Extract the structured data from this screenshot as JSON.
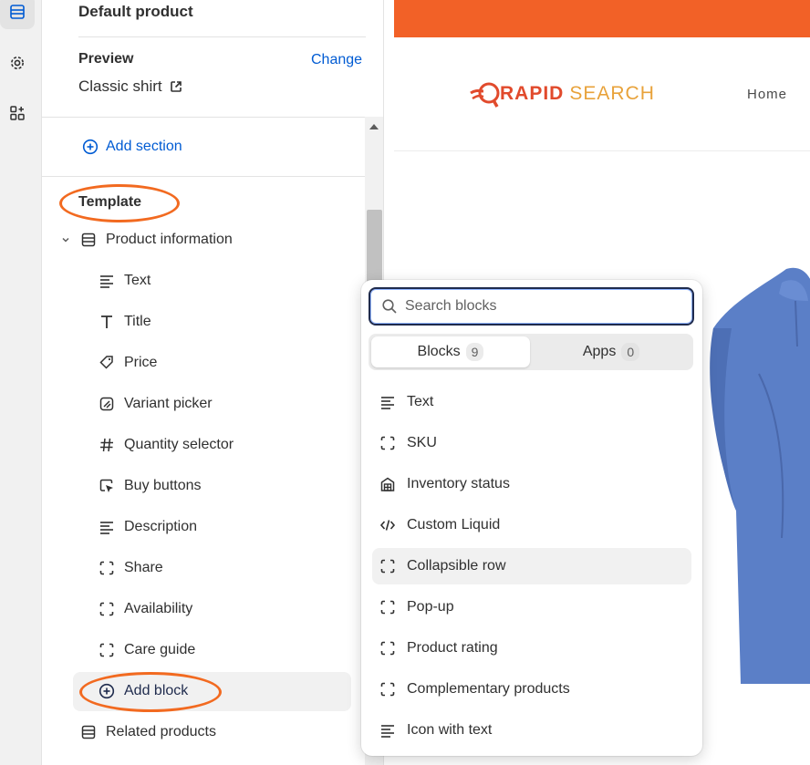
{
  "rail": {
    "items": [
      {
        "icon": "sections-icon",
        "active": true
      },
      {
        "icon": "gear-icon",
        "active": false
      },
      {
        "icon": "apps-icon",
        "active": false
      }
    ]
  },
  "panel": {
    "title": "Default product",
    "preview_label": "Preview",
    "preview_change": "Change",
    "preview_value": "Classic shirt",
    "add_section": "Add section",
    "template_label": "Template",
    "section_name": "Product information",
    "blocks": [
      {
        "label": "Text",
        "icon": "text-icon"
      },
      {
        "label": "Title",
        "icon": "title-icon"
      },
      {
        "label": "Price",
        "icon": "price-tag-icon"
      },
      {
        "label": "Variant picker",
        "icon": "variant-icon"
      },
      {
        "label": "Quantity selector",
        "icon": "hash-icon"
      },
      {
        "label": "Buy buttons",
        "icon": "cursor-icon"
      },
      {
        "label": "Description",
        "icon": "text-icon"
      },
      {
        "label": "Share",
        "icon": "dashed-square-icon"
      },
      {
        "label": "Availability",
        "icon": "dashed-square-icon"
      },
      {
        "label": "Care guide",
        "icon": "dashed-square-icon"
      }
    ],
    "add_block": "Add block",
    "next_section": "Related products"
  },
  "store": {
    "logo_part1": "RAPID",
    "logo_part2": "SEARCH",
    "nav_home": "Home",
    "accent_color": "#f26127"
  },
  "popover": {
    "search_placeholder": "Search blocks",
    "tabs": [
      {
        "label": "Blocks",
        "count": "9"
      },
      {
        "label": "Apps",
        "count": "0"
      }
    ],
    "items": [
      {
        "label": "Text",
        "icon": "text-icon"
      },
      {
        "label": "SKU",
        "icon": "dashed-square-icon"
      },
      {
        "label": "Inventory status",
        "icon": "inventory-icon"
      },
      {
        "label": "Custom Liquid",
        "icon": "code-icon"
      },
      {
        "label": "Collapsible row",
        "icon": "dashed-square-icon"
      },
      {
        "label": "Pop-up",
        "icon": "dashed-square-icon"
      },
      {
        "label": "Product rating",
        "icon": "dashed-square-icon"
      },
      {
        "label": "Complementary products",
        "icon": "dashed-square-icon"
      },
      {
        "label": "Icon with text",
        "icon": "text-icon"
      }
    ]
  },
  "colors": {
    "link": "#005bd3",
    "highlight_ring": "#f26a20"
  }
}
